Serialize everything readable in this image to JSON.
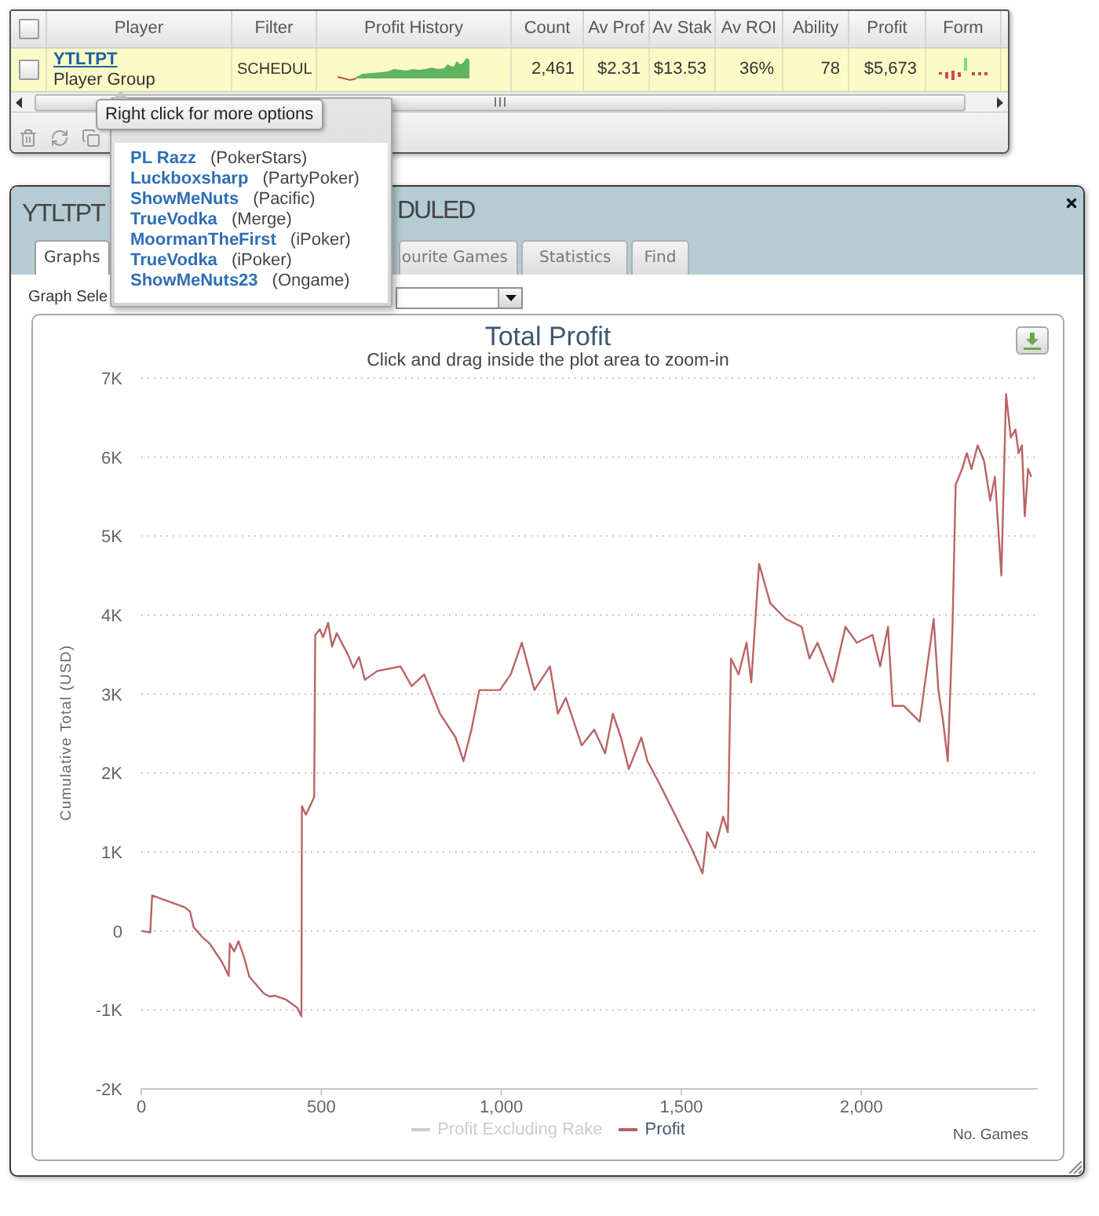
{
  "grid": {
    "select_all": {
      "checked": false
    },
    "columns": [
      "Player",
      "Filter",
      "Profit History",
      "Count",
      "Av Prof",
      "Av Stak",
      "Av ROI",
      "Ability",
      "Profit",
      "Form"
    ],
    "rows": [
      {
        "checked": false,
        "selected": true,
        "player": "YTLTPT",
        "player_type": "Player Group",
        "filter": "SCHEDUL",
        "count": "2,461",
        "av_prof": "$2.31",
        "av_stak": "$13.53",
        "av_roi": "36%",
        "ability": "78",
        "profit": "$5,673"
      }
    ]
  },
  "tooltip": {
    "text": "Right click for more options"
  },
  "context_menu": {
    "items": [
      {
        "player": "PL Razz",
        "site": "(PokerStars)"
      },
      {
        "player": "Luckboxsharp",
        "site": "(PartyPoker)"
      },
      {
        "player": "ShowMeNuts",
        "site": "(Pacific)"
      },
      {
        "player": "TrueVodka",
        "site": "(Merge)"
      },
      {
        "player": "MoormanTheFirst",
        "site": "(iPoker)"
      },
      {
        "player": "TrueVodka",
        "site": "(iPoker)"
      },
      {
        "player": "ShowMeNuts23",
        "site": "(Ongame)"
      }
    ]
  },
  "window": {
    "title_fragments": [
      "YTLTPT",
      "DULED"
    ],
    "tabs": [
      {
        "label": "Graphs",
        "selected": true
      },
      {
        "label": "ourite Games",
        "selected": false
      },
      {
        "label": "Statistics",
        "selected": false
      },
      {
        "label": "Find",
        "selected": false
      }
    ],
    "graph_selector": {
      "label": "Graph Sele"
    }
  },
  "chart": {
    "subtitle": "Click and drag inside the plot area to zoom-in",
    "chart_data": {
      "type": "line",
      "title": "Total Profit",
      "xlabel": "No. Games",
      "ylabel": "Cumulative Total (USD)",
      "grid": true,
      "x": [
        0,
        25,
        30,
        120,
        135,
        145,
        170,
        190,
        225,
        243,
        246,
        258,
        270,
        285,
        300,
        340,
        356,
        371,
        402,
        433,
        445,
        446,
        457,
        472,
        480,
        483,
        496,
        505,
        519,
        530,
        543,
        574,
        589,
        605,
        621,
        655,
        720,
        751,
        786,
        830,
        873,
        895,
        917,
        939,
        996,
        1026,
        1057,
        1092,
        1135,
        1157,
        1179,
        1223,
        1258,
        1288,
        1310,
        1332,
        1354,
        1389,
        1406,
        1441,
        1485,
        1528,
        1559,
        1572,
        1594,
        1616,
        1629,
        1638,
        1659,
        1681,
        1694,
        1716,
        1747,
        1790,
        1834,
        1856,
        1878,
        1921,
        1956,
        1987,
        2031,
        2052,
        2074,
        2087,
        2118,
        2162,
        2201,
        2214,
        2227,
        2240,
        2253,
        2262,
        2280,
        2293,
        2306,
        2323,
        2341,
        2358,
        2371,
        2389,
        2402,
        2415,
        2428,
        2437,
        2446,
        2454,
        2463,
        2472
      ],
      "series": [
        {
          "name": "Profit Excluding Rake",
          "values": [
            null,
            null,
            null,
            null,
            null,
            null,
            null,
            null,
            null,
            null,
            null,
            null,
            null,
            null,
            null,
            null,
            null,
            null,
            null,
            null,
            null,
            null,
            null,
            null,
            null,
            null,
            null,
            null,
            null,
            null,
            null,
            null,
            null,
            null,
            null,
            null,
            null,
            null,
            null,
            null,
            null,
            null,
            null,
            null,
            null,
            null,
            null,
            null,
            null,
            null,
            null,
            null,
            null,
            null,
            null,
            null,
            null,
            null,
            null,
            null,
            null,
            null,
            null,
            null,
            null,
            null,
            null,
            null,
            null,
            null,
            null,
            null,
            null,
            null,
            null,
            null,
            null,
            null,
            null,
            null,
            null,
            null,
            null,
            null,
            null,
            null,
            null,
            null,
            null,
            null,
            null,
            null,
            null,
            null,
            null,
            null,
            null,
            null,
            null,
            null,
            null,
            null,
            null,
            null,
            null,
            null,
            null,
            null
          ]
        },
        {
          "name": "Profit",
          "color": "#b96464",
          "values": [
            0,
            -20,
            450,
            300,
            250,
            50,
            -80,
            -160,
            -400,
            -570,
            -160,
            -260,
            -130,
            -330,
            -580,
            -790,
            -830,
            -820,
            -870,
            -970,
            -1080,
            1580,
            1470,
            1610,
            1700,
            3750,
            3820,
            3720,
            3900,
            3600,
            3770,
            3500,
            3330,
            3470,
            3180,
            3290,
            3350,
            3100,
            3250,
            2750,
            2450,
            2150,
            2550,
            3050,
            3050,
            3250,
            3650,
            3050,
            3350,
            2750,
            2950,
            2350,
            2550,
            2250,
            2750,
            2450,
            2050,
            2450,
            2150,
            1850,
            1450,
            1050,
            730,
            1250,
            1050,
            1450,
            1250,
            3450,
            3250,
            3650,
            3150,
            4650,
            4150,
            3950,
            3850,
            3450,
            3650,
            3150,
            3850,
            3650,
            3750,
            3350,
            3850,
            2850,
            2850,
            2650,
            3950,
            3050,
            2650,
            2150,
            3850,
            5650,
            5850,
            6050,
            5850,
            6150,
            5950,
            5450,
            5750,
            4500,
            6800,
            6250,
            6350,
            6050,
            6150,
            5250,
            5850,
            5750
          ]
        }
      ],
      "xlim": [
        0,
        2490
      ],
      "ylim": [
        -2000,
        7000
      ],
      "xticks": [
        {
          "value": 0,
          "label": "0"
        },
        {
          "value": 500,
          "label": "500"
        },
        {
          "value": 1000,
          "label": "1,000"
        },
        {
          "value": 1500,
          "label": "1,500"
        },
        {
          "value": 2000,
          "label": "2,000"
        }
      ],
      "yticks": [
        {
          "value": -2000,
          "label": "-2K"
        },
        {
          "value": -1000,
          "label": "-1K"
        },
        {
          "value": 0,
          "label": "0"
        },
        {
          "value": 1000,
          "label": "1K"
        },
        {
          "value": 2000,
          "label": "2K"
        },
        {
          "value": 3000,
          "label": "3K"
        },
        {
          "value": 4000,
          "label": "4K"
        },
        {
          "value": 5000,
          "label": "5K"
        },
        {
          "value": 6000,
          "label": "6K"
        },
        {
          "value": 7000,
          "label": "7K"
        }
      ]
    }
  }
}
